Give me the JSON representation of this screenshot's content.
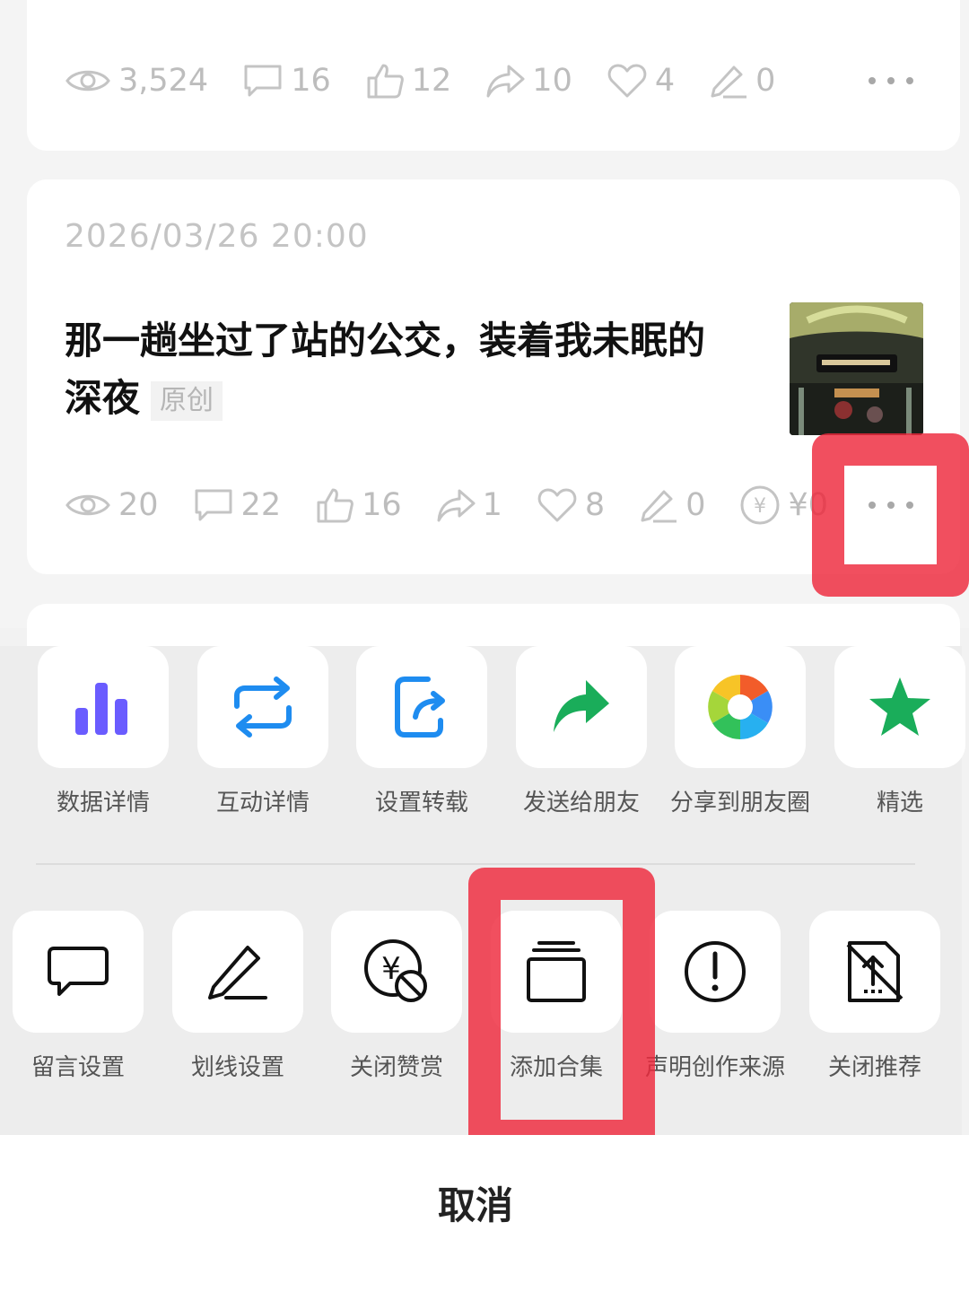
{
  "post_prev": {
    "stats": {
      "views": "3,524",
      "comments": "16",
      "likes": "12",
      "shares": "10",
      "favorites": "4",
      "underlines": "0"
    }
  },
  "post": {
    "date": "2026/03/26 20:00",
    "title": "那一趟坐过了站的公交，装着我未眠的深夜",
    "badge": "原创",
    "stats": {
      "views": "20",
      "comments": "22",
      "likes": "16",
      "shares": "1",
      "favorites": "8",
      "underlines": "0",
      "reward": "¥0"
    }
  },
  "sheet": {
    "row1": [
      {
        "label": "数据详情",
        "icon": "bar-chart-icon"
      },
      {
        "label": "互动详情",
        "icon": "repeat-icon"
      },
      {
        "label": "设置转载",
        "icon": "export-icon"
      },
      {
        "label": "发送给朋友",
        "icon": "share-arrow-icon"
      },
      {
        "label": "分享到朋友圈",
        "icon": "moments-icon"
      },
      {
        "label": "精选",
        "icon": "star-icon"
      }
    ],
    "row2": [
      {
        "label": "留言设置",
        "icon": "comment-icon"
      },
      {
        "label": "划线设置",
        "icon": "pen-icon"
      },
      {
        "label": "关闭赞赏",
        "icon": "no-reward-icon"
      },
      {
        "label": "添加合集",
        "icon": "collection-icon"
      },
      {
        "label": "声明创作来源",
        "icon": "alert-icon"
      },
      {
        "label": "关闭推荐",
        "icon": "no-recommend-icon"
      }
    ],
    "cancel": "取消"
  },
  "colors": {
    "highlight": "#ee283c",
    "chart_purple": "#6a5cff",
    "interact_blue": "#1e8cf0",
    "wechat_green": "#1aad5a"
  }
}
